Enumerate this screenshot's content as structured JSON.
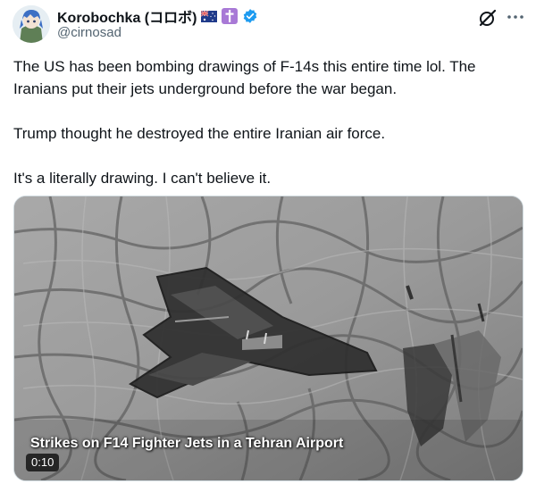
{
  "author": {
    "display_name": "Korobochka (コロボ)",
    "handle": "@cirnosad",
    "badges": [
      "australia-flag-icon",
      "cross-icon",
      "verified-badge-icon"
    ],
    "verified_color": "#1d9bf0"
  },
  "header_actions": {
    "grok": "grok-icon",
    "more": "more-options-icon"
  },
  "tweet": {
    "paragraphs": [
      "The US has been bombing drawings of F-14s this entire time lol. The Iranians put their jets underground before the war began.",
      "Trump thought he destroyed the entire Iranian air force.",
      "It's a literally drawing. I can't believe it."
    ]
  },
  "media": {
    "type": "video",
    "caption": "Strikes on F14 Fighter Jets in a Tehran Airport",
    "duration": "0:10"
  }
}
